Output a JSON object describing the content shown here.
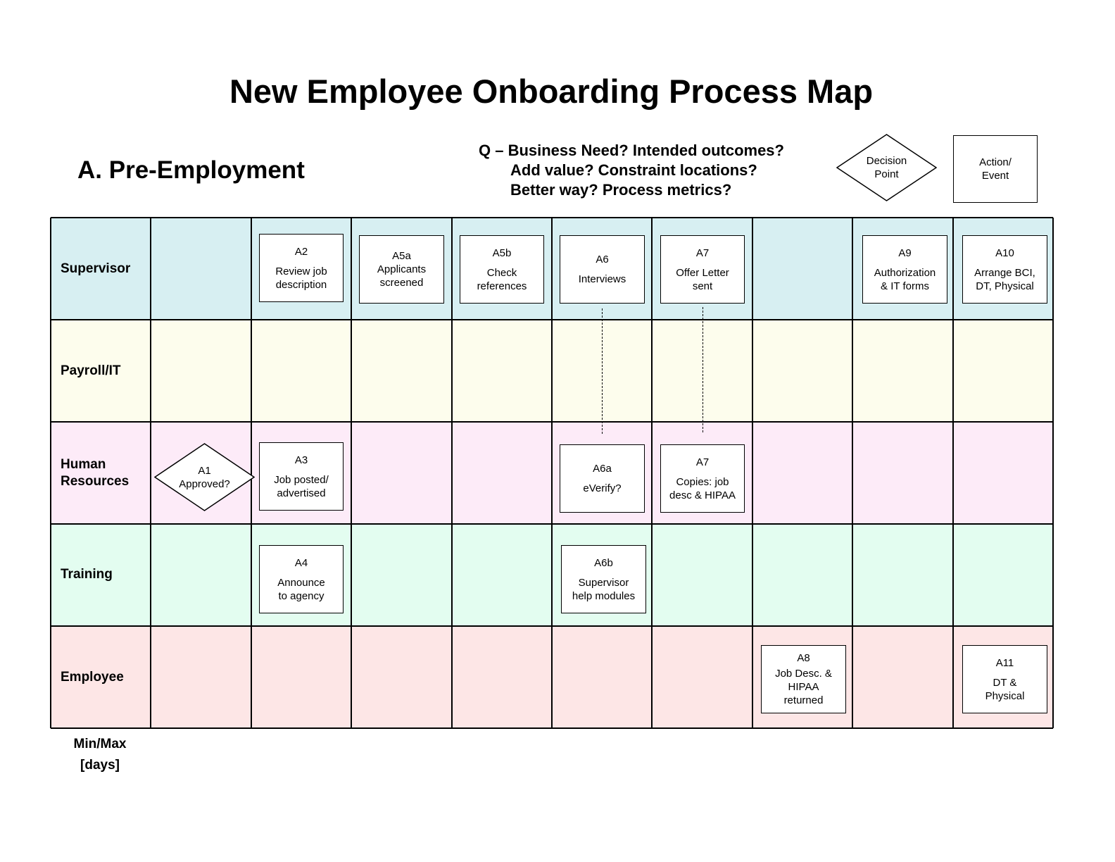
{
  "title": "New Employee Onboarding Process Map",
  "section": "A.  Pre-Employment",
  "questions": [
    "Q – Business Need?  Intended outcomes?",
    "Add value?  Constraint locations?",
    "Better way?  Process metrics?"
  ],
  "legend": {
    "decision": "Decision\nPoint",
    "action": "Action/\nEvent"
  },
  "lanes": [
    {
      "label": "Supervisor",
      "color": "#d7eff2"
    },
    {
      "label": "Payroll/IT",
      "color": "#fdfded"
    },
    {
      "label": "Human\nResources",
      "color": "#fdebf8"
    },
    {
      "label": "Training",
      "color": "#e3fdf0"
    },
    {
      "label": "Employee",
      "color": "#fde6e6"
    }
  ],
  "nodes": {
    "a1": {
      "id": "A1",
      "text": "Approved?"
    },
    "a2": {
      "id": "A2",
      "text": "Review job\ndescription"
    },
    "a3": {
      "id": "A3",
      "text": "Job posted/\nadvertised"
    },
    "a4": {
      "id": "A4",
      "text": "Announce\nto agency"
    },
    "a5a": {
      "id": "A5a",
      "text": "Applicants\nscreened"
    },
    "a5b": {
      "id": "A5b",
      "text": "Check\nreferences"
    },
    "a6": {
      "id": "A6",
      "text": "Interviews"
    },
    "a6a": {
      "id": "A6a",
      "text": "eVerify?"
    },
    "a6b": {
      "id": "A6b",
      "text": "Supervisor\nhelp  modules"
    },
    "a7": {
      "id": "A7",
      "text": "Offer Letter\nsent"
    },
    "a7hr": {
      "id": "A7",
      "text": "Copies: job\ndesc & HIPAA"
    },
    "a8": {
      "id": "A8",
      "text": "Job Desc. &\nHIPAA\nreturned"
    },
    "a9": {
      "id": "A9",
      "text": "Authorization\n& IT forms"
    },
    "a10": {
      "id": "A10",
      "text": "Arrange BCI,\nDT, Physical"
    },
    "a11": {
      "id": "A11",
      "text": "DT &\nPhysical"
    }
  },
  "footer": "Min/Max\n[days]"
}
